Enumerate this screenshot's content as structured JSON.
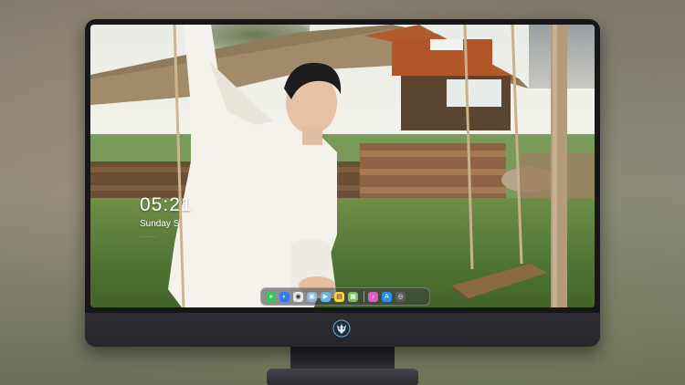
{
  "lock_screen": {
    "time": "05:21",
    "date": "Sunday S",
    "subtitle": "… … … …"
  },
  "dock": {
    "apps": [
      {
        "icon": "messages-icon",
        "color": "#34c759",
        "glyph": "●"
      },
      {
        "icon": "finder-icon",
        "color": "#2f7bf5",
        "glyph": "◐"
      },
      {
        "icon": "chrome-icon",
        "color": "#e6e6e6",
        "glyph": "◉"
      },
      {
        "icon": "preview-icon",
        "color": "#8fb3d9",
        "glyph": "▣"
      },
      {
        "icon": "clapper-icon",
        "color": "#5fb6e8",
        "glyph": "▶"
      },
      {
        "icon": "notes-icon",
        "color": "#f5d547",
        "glyph": "▤"
      },
      {
        "icon": "photos-icon",
        "color": "#7fbf6a",
        "glyph": "▦"
      },
      {
        "icon": "itunes-icon",
        "color": "#e459c4",
        "glyph": "♪"
      },
      {
        "icon": "app-store-icon",
        "color": "#2f8ff0",
        "glyph": "A"
      },
      {
        "icon": "camera-icon",
        "color": "#5a5a60",
        "glyph": "◎"
      }
    ]
  },
  "monitor": {
    "logo_icon": "wolf-logo-icon"
  }
}
